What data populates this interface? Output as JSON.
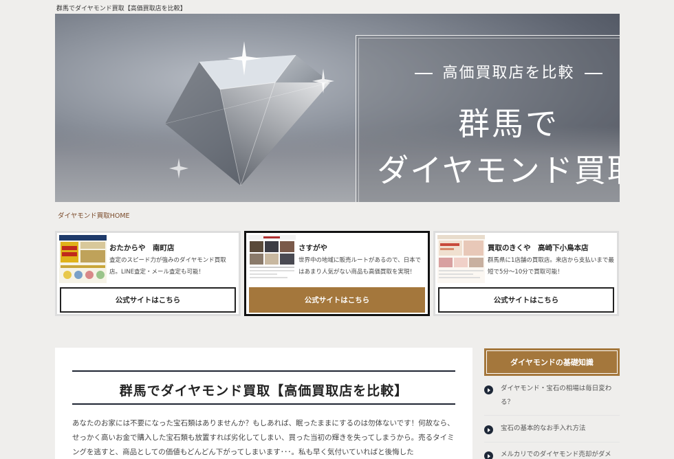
{
  "site_title": "群馬でダイヤモンド買取【高価買取店を比較】",
  "hero": {
    "subtitle": "高価買取店を比較",
    "title_line1": "群馬で",
    "title_line2": "ダイヤモンド買取"
  },
  "breadcrumb": "ダイヤモンド買取HOME",
  "cards": [
    {
      "name": "おたからや　南町店",
      "desc": "査定のスピード力が強みのダイヤモンド買取店。LINE査定・メール査定も可能！",
      "button": "公式サイトはこちら",
      "featured": false
    },
    {
      "name": "さすがや",
      "desc": "世界中の地域に販売ルートがあるので、日本ではあまり人気がない商品も高価買取を実現！",
      "button": "公式サイトはこちら",
      "featured": true
    },
    {
      "name": "買取のきくや　高崎下小鳥本店",
      "desc": "群馬県に1店舗の買取店。来店から支払いまで最短で5分〜10分で買取可能！",
      "button": "公式サイトはこちら",
      "featured": false
    }
  ],
  "article": {
    "heading": "群馬でダイヤモンド買取【高価買取店を比較】",
    "body": "あなたのお家には不要になった宝石類はありませんか？もしあれば、眠ったままにするのは勿体ないです！何故なら、せっかく高いお金で購入した宝石類も放置すれば劣化してしまい、買った当初の輝きを失ってしまうから。売るタイミングを逃すと、商品としての価値もどんどん下がってしまいます･･･。私も早く気付いていればと後悔した"
  },
  "sidebar": {
    "heading": "ダイヤモンドの基礎知識",
    "items": [
      "ダイヤモンド・宝石の相場は毎日変わる？",
      "宝石の基本的なお手入れ方法",
      "メルカリでのダイヤモンド売却がダメ"
    ]
  },
  "colors": {
    "accent": "#a4773c",
    "navy": "#1e2432",
    "background": "#efeeec"
  }
}
